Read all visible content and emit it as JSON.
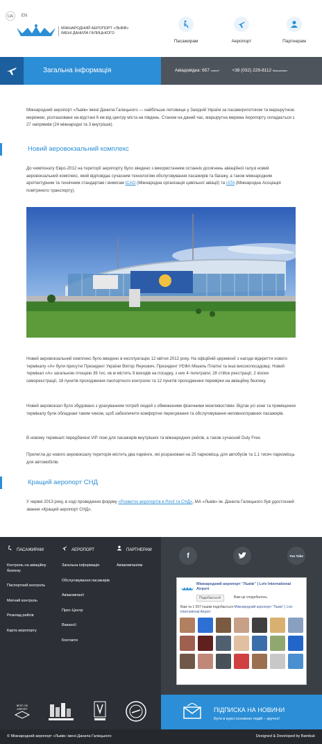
{
  "header": {
    "lang_ua": "UA",
    "lang_en": "EN",
    "logo_line1": "МІЖНАРОДНИЙ АЕРОПОРТ «ЛЬВІВ»",
    "logo_line2": "ІМЕНІ ДАНИЛА ГАЛИЦЬКОГО",
    "nav": [
      {
        "label": "Пасажирам",
        "icon": "passenger-icon"
      },
      {
        "label": "Аеропорт",
        "icon": "plane-icon"
      },
      {
        "label": "Партнерам",
        "icon": "partners-icon"
      }
    ]
  },
  "banner": {
    "title": "Загальна інформація",
    "helpdesk_label": "Авіадовідка: 657",
    "helpdesk_note": "платно*",
    "phone": "+38 (032) 229-8112",
    "phone_note": "безкоштовно"
  },
  "content": {
    "intro": "Міжнародний аеропорт «Львів» імені Данила Галицького — найбільше летовище у Західній Україні за пасажиропотоком та маршрутною мережею, розташоване на відстані 6 км від центру міста на південь. Станом на даний час, маршрутна мережа Аеропорту складається з 27 напрямків (24 міжнародні та 3 внутрішні).",
    "section1_title": "Новий аеровокзальний комплекс",
    "para1_a": "До чемпіонату Євро-2012 на території аеропорту було зведено з використанням останніх досягнень авіаційної галузі новий аеровокзальний комплекс, який відповідає сучасним технологіям обслуговування пасажирів та багажу, а також міжнародним архітектурним та технічним стандартам і вимогам ",
    "para1_icao": "ICAO",
    "para1_b": " (Міжнародна організація цивільної авіації) та ",
    "para1_iata": "IATA",
    "para1_c": " (Міжнародна Асоціація повітряного транспорту).",
    "para2": "Новий аеровокзальний комплекс було введено в експлуатацію 12 квітня 2012 року. На офіційній церемонії з нагоди відкриття нового терміналу «А» були присутні Президент України Віктор Янукович, Президент УЄФА Мішель Платіні та інші високопосадовці. Новий термінал «А» загальною площею 39 тис. кв.м містить 9 виходів на посадку, з них 4-телетрапи; 28 стійок реєстрації, 2 кіоски самореєстрації, 18 пунктів проходження паспортного контролю та 12 пунктів проходження перевірки на авіаційну безпеку.",
    "para3": "Новий аеровокзал було збудовано з урахуванням потреб людей з обмеженими фізичними можливостями. Відтак усі зони та приміщення терміналу були обладнані таким чином, щоб забезпечити комфортне пересування та обслуговування неповносправних пасажирів.",
    "para4": "В новому терміналі передбачені VIP ложі для пасажирів внутрішніх та міжнародних рейсів, а також сучасний Duty Free.",
    "para5": "Прилегла до нового аеровокзалу територія містить два паркінги, які розраховані на 25 паркомісць для автобусів та 1,1 тисяч паркомісць для автомобілів.",
    "section2_title": "Кращий аеропорт СНД",
    "para6_a": "У червні 2013 року, в ході проведення форуму ",
    "para6_link": "«Розвиток аеропортів в Росії та СНД»",
    "para6_b": ", МА «Львів» ім. Данила Галицького був удостоєний звання  «Кращий аеропорт СНД»."
  },
  "footer": {
    "col1": {
      "title": "ПАСАЖИРАМ",
      "links": [
        "Контроль на авіаційну безпеку",
        "Паспортний контроль",
        "Митний контроль",
        "Розклад рейсів",
        "Карта аеропорту"
      ]
    },
    "col2": {
      "title": "АЕРОПОРТ",
      "links": [
        "Загальна інформація",
        "Обслуговування пасажирів",
        "Авіакомпанії",
        "Прес-Центр",
        "Вакансії",
        "Контакти"
      ]
    },
    "col3": {
      "title": "ПАРТНЕРАМ",
      "links": [
        "Авіакомпаніям"
      ]
    },
    "social": [
      "f",
      "t",
      "You Tube"
    ],
    "fb": {
      "page_name": "Міжнародний аеропорт \"Львів\" | Lviv International Airport",
      "like_button": "Подобається!",
      "liked_text": "Вам це сподобалось.",
      "count_text_a": "Вам та 1 097 іншим подобається ",
      "count_text_b": "Міжнародний аеропорт \"Львів\" | Lviv International Airport"
    },
    "partners_label_1": "BEST CIS AIRPORT",
    "subscribe_title": "ПІДПИСКА НА НОВИНИ",
    "subscribe_text": "Бути в курсі основних подій – зручно!",
    "copyright": "© Міжнародний аеропорт «Львів» імені Данила Галицького",
    "credits": "Designed & Developed by Bambuk"
  }
}
